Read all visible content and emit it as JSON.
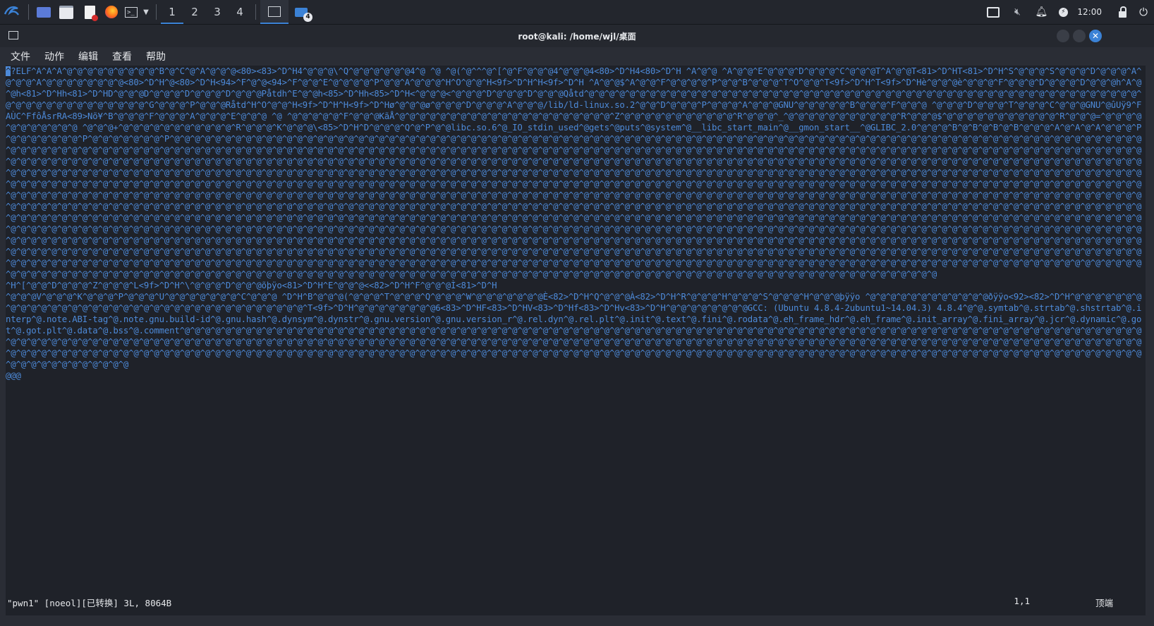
{
  "panel": {
    "workspaces": [
      "1",
      "2",
      "3",
      "4"
    ],
    "badge": "4",
    "clock": "12:00",
    "icons": [
      "kali-menu-icon",
      "desktop-icon",
      "file-manager-icon",
      "text-editor-icon",
      "firefox-icon",
      "terminal-icon",
      "chevron-down-icon",
      "terminal-window-icon",
      "folder-window-icon",
      "display-icon",
      "mute-icon",
      "bell-icon",
      "power-icon",
      "lock-icon",
      "logout-icon"
    ]
  },
  "window": {
    "title": "root@kali: /home/wjl/桌面",
    "menu": [
      "文件",
      "动作",
      "编辑",
      "查看",
      "帮助"
    ]
  },
  "terminal": {
    "cursor_char": "^",
    "head": "?ELF^A^A^A^@^@^@^@^@^@^@^@^@^B^@^C^@^A^@^@^@<80><83>^D^H4^@^@^@\\^Q^@^@^@^@^@^@4^@ ^@ ^@(^@^^^@^[^@^F^@^@^@4^@^@^@4<80>^D^H4<80>^D^H ^A^@^@ ^A^@^@^E^@^@^@^D^@^@^@^C^@^@^@T^A^@^@T<81>^D^HT<81>^D^H^S^@^@^@^S^@^@^@^D^@^@^@^A^@^@^@^A^@^@^@^@^@^@^@^@<80>^D^H^@<80>^D^H<94>^F^@^@<94>^F^@^@^E^@^@^@^@^P^@^@^A^@^@^@^H^O^@^@^H<9f>^D^H^H<9f>^D^H ^A^@^@$^A^@^@^F^@^@^@^@^P^@^@^B^@^@^@^T^O^@^@^T<9f>^D^H^T<9f>^D^Hè^@^@^@è^@^@^@^F^@^@^@^D^@^@^@^D^@^@^@h^A^@^@h<81>^D^Hh<81>^D^HD^@^@^@D^@^@^@^D^@^@^@^D^@^@^@Påtdh^E^@^@h<85>^D^Hh<85>^D^H<^@^@^@<^@^@^@^D^@^@^@^D^@^@^@Qåtd^@^@^@^@^@^@^@^@^@^@^@^@^@^@^@^@^@^@^@^@^@^@^@^@^@^@^@^@^@^@^@^@^@^@^@^@^@^@^@^@^@^@^@^@^@^@^@^@^@^@^@^@^@^@^@^@^@^@^@^@^@^@^@^@^@^@^@^@^G^@^@^@^P^@^@^@Råtd^H^O^@^@^H<9f>^D^H^H<9f>^D^Hø^@^@^@ø^@^@^@^D^@^@^@^A^@^@^@/lib/ld-linux.so.2^@^@^D^@^@^@^P^@^@^@^A^@^@^@GNU^@^@^@^@^@^B^@^@^@^F^@^@^@ ^@^@^@^D^@^@^@^T^@^@^@^C^@^@^@GNU^@ûUÿ9^FAÙC^FfôÅsrRA<89>Nõ¥^B^@^@^@^F^@^@^@^A^@^@^@^E^@^@^@ ^@ ^@^@^@^@^@^F^@^@^@KãÅ^@^@^@^@^@^@^@^@^@^@^@^@^@^@^@^@^@^@^@^@^@^Z^@^@^@^@^@^@^@^@^@^@^@^R^@^@^@^_^@^@^@^@^@^@^@^@^@^@^@^R^@^@^@$^@^@^@^@^@^@^@^@^@^@^@^R^@^@^@=^@^@^@^@^@^@^@^@^@^@^@ ^@^@^@+^@^@^@^@^@^@^@^@^@^@^@^R^@^@^@^K^@^@^@\\<85>^D^H^D^@^@^@^Q^@^P^@^@libc.so.6^@_IO_stdin_used^@gets^@puts^@system^@__libc_start_main^@__gmon_start__^@GLIBC_2.0^@^@^@^B^@^B^@^B^@^B^@^@^@^A^@^A^@^A^@^@^@^P^@^@^@^@^@^@^@^P^@^@^@^@^@^@^@^P^@^@^@^@^@^@^@^@^@^@^@^@^@^@^@^@^@^@^@^@^@^@^@^@^@^@^@^@^@^@^@^@^@^@^@^@^@^@^@^@^@^@^@^@^@^@^@^@^@^@^@^@^@^@^@^@^@^@^@^@^@^@^@^@^@^@^@^@^@^@^@^@^@^@^@^@^@^@^@^@^@^@^@^@^@^@^@^@^@^@^@^@^@^@^@^@^@^@^@^@^@^@^@^@^@^@^@",
    "fill_repeat": 1300,
    "tail_line_1": "^H^[^@^@^D^@^@^@^Z^@^@^@^L<9f>^D^H^\\^@^@^@^D^@^@^@õþÿo<81>^D^H^E^@^@^@<<82>^D^H^F^@^@^@Ì<81>^D^H",
    "tail_line_2": "^@^@^@V^@^@^@^K^@^@^@^P^@^@^@^U^@^@^@^@^@^@^@^C^@^@^@ ^D^H^B^@^@^@(^@^@^@^T^@^@^@^Q^@^@^@^W^@^@^@^@^@^@^@È<82>^D^H^Q^@^@^@À<82>^D^H^R^@^@^@^H^@^@^@^S^@^@^@^H^@^@^@þÿÿo ^@^@^@^@^@^@^@^@^@^@^@^@ðÿÿo<92><82>^D^H^@^@^@^@^@^@^@^@^@^@^@^@^@^@^@^@^@^@^@^@^@^@^@^@^@^@^@^@^@^@^@^@^@^@^@^@^T<9f>^D^H^@^@^@^@^@^@^@^@6<83>^D^HF<83>^D^HV<83>^D^Hf<83>^D^Hv<83>^D^H^@^@^@^@^@^@^@^@GCC: (Ubuntu 4.8.4-2ubuntu1~14.04.3) 4.8.4^@^@.symtab^@.strtab^@.shstrtab^@.interp^@.note.ABI-tag^@.note.gnu.build-id^@.gnu.hash^@.dynsym^@.dynstr^@.gnu.version^@.gnu.version_r^@.rel.dyn^@.rel.plt^@.init^@.text^@.fini^@.rodata^@.eh_frame_hdr^@.eh_frame^@.init_array^@.fini_array^@.jcr^@.dynamic^@.got^@.got.plt^@.data^@.bss^@.comment^@^@^@^@^@^@^@^@^@^@^@^@^@^@^@^@^@^@^@^@^@^@^@^@^@^@^@^@^@^@^@^@^@^@^@^@^@^@^@^@^@^@^@^@^@^@^@^@^@^@^@^@^@^@^@^@^@^@^@^@^@^@^@^@^@^@^@^@^@^@^@^@^@^@^@^@^@^@^@^@^@^@^@^@^@^@^@^@^@^@^@^@^@^@^@^@^@^@^@^@^@^@^@^@^@^@^@^@^@^@^@^@^@^@^@^@^@^@^@^@^@^@^@^@^@^@^@^@^@^@^@^@^@^@^@^@^@^@^@^@^@^@^@^@^@^@^@^@^@^@^@^@^@^@^@^@^@^@^@^@^@^@^@^@^@^@^@^@^@^@^@^@^@^@^@^@^@^@^@^@^@^@^@^@^@^@^@^@^@^@^@^@^@^@^@^@^@^@^@^@^@^@^@^@^@^@^@^@^@^@^@^@^@^@^@^@^@^@^@^@^@^@^@^@^@^@^@^@^@^@^@^@^@^@^@^@^@^@^@^@^@^@^@^@^@^@^@^@^@^@^@^@^@^@^@^@^@^@^@^@^@^@^@^@^@^@^@^@^@^@^@^@^@^@^@^@^@^@^@^@^@^@^@^@^@^@^@^@^@^@^@^@^@^@^@^@^@^@^@^@^@^@^@^@^@^@^@^@^@^@^@^@^@^@^@^@^@^@^@^@^@^@^@^@^@^@^@^@",
    "last_line": "@@@"
  },
  "statusline": {
    "file_info": "\"pwn1\" [noeol][已转换] 3L, 8064B",
    "position": "1,1",
    "scroll": "顶端"
  }
}
